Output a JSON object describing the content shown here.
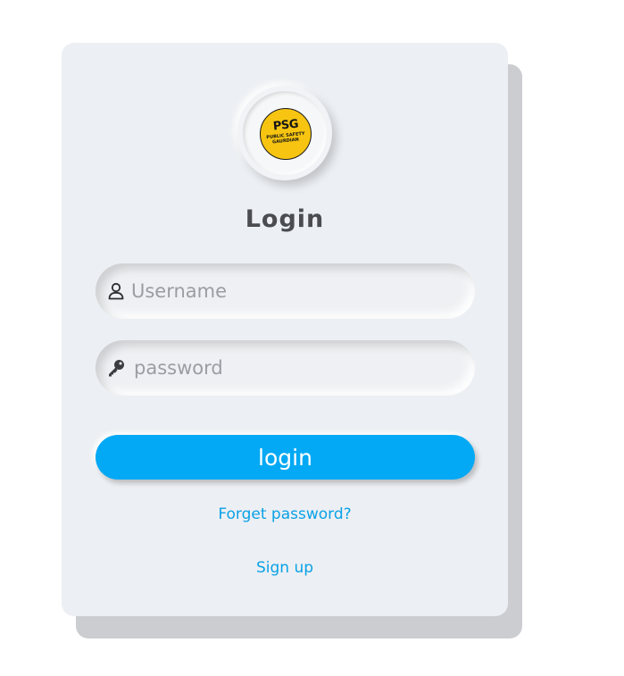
{
  "logo": {
    "main_text": "PSG",
    "sub_text_1": "PUBLIC SAFETY",
    "sub_text_2": "GAURDIAN"
  },
  "form": {
    "title": "Login",
    "username": {
      "placeholder": "Username",
      "value": "",
      "icon": "user-icon"
    },
    "password": {
      "placeholder": "password",
      "value": "",
      "icon": "key-icon"
    },
    "submit_label": "login",
    "forgot_label": "Forget password?",
    "signup_label": "Sign up"
  },
  "colors": {
    "accent": "#03a9f4",
    "link": "#0aa2e6",
    "card": "#eceff3",
    "card_shadow": "#cbcdd1",
    "logo_yellow": "#f7c511",
    "title": "#4a4c50"
  }
}
